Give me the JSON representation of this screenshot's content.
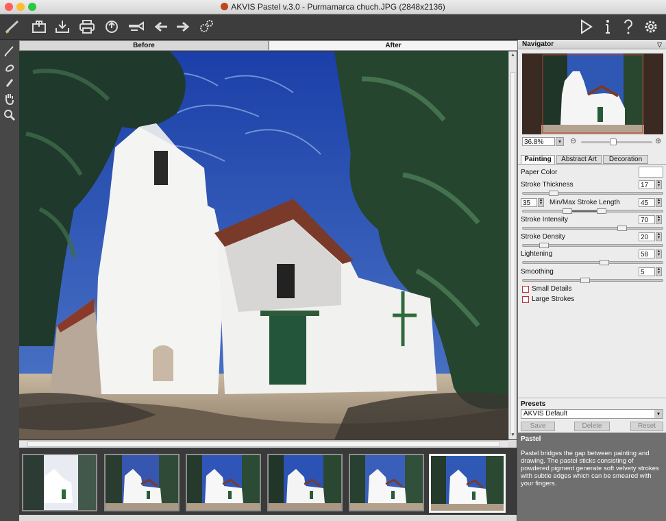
{
  "window": {
    "title": "AKVIS Pastel v.3.0 - Purmamarca chuch.JPG (2848x2136)",
    "traffic_lights": [
      "#ff5f57",
      "#febc2e",
      "#28c840"
    ]
  },
  "toolbar": {
    "left_icons": [
      "pastel-logo-icon",
      "open-icon",
      "save-icon",
      "print-icon",
      "share-icon",
      "batch-icon",
      "undo-arrow-icon",
      "redo-arrow-icon",
      "settings-gears-icon"
    ],
    "right_icons": [
      "play-icon",
      "info-icon",
      "help-icon",
      "preferences-icon"
    ]
  },
  "tools": [
    "brush-icon",
    "eraser-icon",
    "smudge-icon",
    "hand-icon",
    "zoom-icon"
  ],
  "view_tabs": {
    "before": "Before",
    "after": "After"
  },
  "navigator": {
    "title": "Navigator",
    "zoom": "36.8%",
    "zoom_level": 0.45
  },
  "settings_tabs": [
    "Painting",
    "Abstract Art",
    "Decoration"
  ],
  "painting": {
    "paper_color_label": "Paper Color",
    "paper_color": "#ffffff",
    "stroke_thickness": {
      "label": "Stroke Thickness",
      "value": "17"
    },
    "stroke_length": {
      "label": "Min/Max Stroke Length",
      "min": "35",
      "max": "45"
    },
    "stroke_intensity": {
      "label": "Stroke Intensity",
      "value": "70"
    },
    "stroke_density": {
      "label": "Stroke Density",
      "value": "20"
    },
    "lightening": {
      "label": "Lightening",
      "value": "58"
    },
    "smoothing": {
      "label": "Smoothing",
      "value": "5"
    },
    "small_details": "Small Details",
    "large_strokes": "Large Strokes"
  },
  "presets": {
    "title": "Presets",
    "selected": "AKVIS Default",
    "save": "Save",
    "delete": "Delete",
    "reset": "Reset"
  },
  "description": {
    "title": "Pastel",
    "text": "Pastel bridges the gap between painting and drawing. The pastel sticks consisting of powdered pigment generate soft velvety strokes with subtle edges which can be smeared with your fingers."
  }
}
